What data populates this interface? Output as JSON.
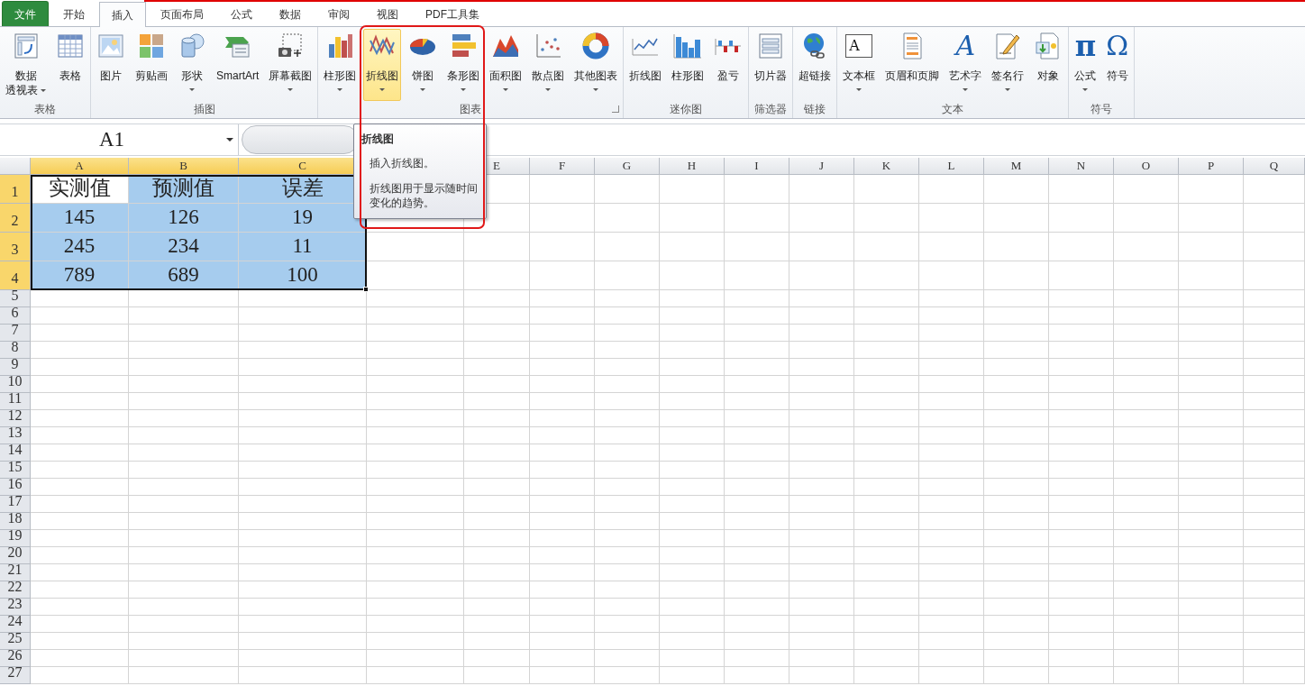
{
  "tabs": [
    {
      "label": "文件",
      "kind": "file",
      "selected": false
    },
    {
      "label": "开始",
      "kind": "tab",
      "selected": false
    },
    {
      "label": "插入",
      "kind": "tab",
      "selected": true
    },
    {
      "label": "页面布局",
      "kind": "tab",
      "selected": false
    },
    {
      "label": "公式",
      "kind": "tab",
      "selected": false
    },
    {
      "label": "数据",
      "kind": "tab",
      "selected": false
    },
    {
      "label": "审阅",
      "kind": "tab",
      "selected": false
    },
    {
      "label": "视图",
      "kind": "tab",
      "selected": false
    },
    {
      "label": "PDF工具集",
      "kind": "tab",
      "selected": false
    }
  ],
  "ribbon": [
    {
      "label": "表格",
      "launcher": false,
      "buttons": [
        {
          "label": "数据",
          "label_2": "透视表",
          "dropdown": true,
          "highlighted": false
        },
        {
          "label": "表格",
          "dropdown": false,
          "highlighted": false
        }
      ]
    },
    {
      "label": "插图",
      "launcher": false,
      "buttons": [
        {
          "label": "图片",
          "dropdown": false,
          "highlighted": false
        },
        {
          "label": "剪贴画",
          "dropdown": false,
          "highlighted": false
        },
        {
          "label": "形状",
          "dropdown": true,
          "highlighted": false
        },
        {
          "label": "SmartArt",
          "dropdown": false,
          "highlighted": false
        },
        {
          "label": "屏幕截图",
          "dropdown": true,
          "highlighted": false
        }
      ]
    },
    {
      "label": "图表",
      "launcher": true,
      "buttons": [
        {
          "label": "柱形图",
          "dropdown": true,
          "highlighted": false
        },
        {
          "label": "折线图",
          "dropdown": true,
          "highlighted": true
        },
        {
          "label": "饼图",
          "dropdown": true,
          "highlighted": false
        },
        {
          "label": "条形图",
          "dropdown": true,
          "highlighted": false
        },
        {
          "label": "面积图",
          "dropdown": true,
          "highlighted": false
        },
        {
          "label": "散点图",
          "dropdown": true,
          "highlighted": false
        },
        {
          "label": "其他图表",
          "dropdown": true,
          "highlighted": false
        }
      ]
    },
    {
      "label": "迷你图",
      "launcher": false,
      "buttons": [
        {
          "label": "折线图",
          "dropdown": false,
          "highlighted": false
        },
        {
          "label": "柱形图",
          "dropdown": false,
          "highlighted": false
        },
        {
          "label": "盈亏",
          "dropdown": false,
          "highlighted": false
        }
      ]
    },
    {
      "label": "筛选器",
      "launcher": false,
      "buttons": [
        {
          "label": "切片器",
          "dropdown": false,
          "highlighted": false
        }
      ]
    },
    {
      "label": "链接",
      "launcher": false,
      "buttons": [
        {
          "label": "超链接",
          "dropdown": false,
          "highlighted": false
        }
      ]
    },
    {
      "label": "文本",
      "launcher": false,
      "buttons": [
        {
          "label": "文本框",
          "glyph": "A",
          "dropdown": true,
          "highlighted": false
        },
        {
          "label": "页眉和页脚",
          "dropdown": false,
          "highlighted": false
        },
        {
          "label": "艺术字",
          "glyph": "A",
          "dropdown": true,
          "highlighted": false
        },
        {
          "label": "签名行",
          "dropdown": true,
          "highlighted": false
        },
        {
          "label": "对象",
          "dropdown": false,
          "highlighted": false
        }
      ]
    },
    {
      "label": "符号",
      "launcher": false,
      "buttons": [
        {
          "label": "公式",
          "glyph": "π",
          "dropdown": true,
          "highlighted": false
        },
        {
          "label": "符号",
          "glyph": "Ω",
          "dropdown": false,
          "highlighted": false
        }
      ]
    }
  ],
  "formula_bar": {
    "name_box": "A1"
  },
  "tooltip": {
    "title": "折线图",
    "lines": [
      "插入折线图。",
      "折线图用于显示随时间变化的趋势。"
    ]
  },
  "sheet": {
    "columns": [
      {
        "label": "A",
        "selected": true
      },
      {
        "label": "B",
        "selected": true
      },
      {
        "label": "C",
        "selected": true
      },
      {},
      {
        "label": "E",
        "selected": false
      },
      {
        "label": "F",
        "selected": false
      },
      {
        "label": "G",
        "selected": false
      },
      {
        "label": "H",
        "selected": false
      },
      {
        "label": "I",
        "selected": false
      },
      {
        "label": "J",
        "selected": false
      },
      {
        "label": "K",
        "selected": false
      },
      {
        "label": "L",
        "selected": false
      },
      {
        "label": "M",
        "selected": false
      },
      {
        "label": "N",
        "selected": false
      },
      {
        "label": "O",
        "selected": false
      },
      {
        "label": "P",
        "selected": false
      },
      {
        "label": "Q",
        "selected": false
      }
    ],
    "rows": [
      {
        "label": "1",
        "selected": true,
        "cells": [
          {
            "text": "实测值",
            "selected": true,
            "active": true
          },
          {
            "text": "预测值",
            "selected": true,
            "active": false
          },
          {
            "text": "误差",
            "selected": true,
            "active": false
          }
        ]
      },
      {
        "label": "2",
        "selected": true,
        "cells": [
          {
            "text": "145",
            "selected": true,
            "active": false
          },
          {
            "text": "126",
            "selected": true,
            "active": false
          },
          {
            "text": "19",
            "selected": true,
            "active": false
          }
        ]
      },
      {
        "label": "3",
        "selected": true,
        "cells": [
          {
            "text": "245",
            "selected": true,
            "active": false
          },
          {
            "text": "234",
            "selected": true,
            "active": false
          },
          {
            "text": "11",
            "selected": true,
            "active": false
          }
        ]
      },
      {
        "label": "4",
        "selected": true,
        "cells": [
          {
            "text": "789",
            "selected": true,
            "active": false
          },
          {
            "text": "689",
            "selected": true,
            "active": false
          },
          {
            "text": "100",
            "selected": true,
            "active": false
          }
        ]
      },
      {
        "label": "5",
        "selected": false
      },
      {
        "label": "6",
        "selected": false
      },
      {
        "label": "7",
        "selected": false
      },
      {
        "label": "8",
        "selected": false
      },
      {
        "label": "9",
        "selected": false
      },
      {
        "label": "10",
        "selected": false
      },
      {
        "label": "11",
        "selected": false
      },
      {
        "label": "12",
        "selected": false
      },
      {
        "label": "13",
        "selected": false
      },
      {
        "label": "14",
        "selected": false
      },
      {
        "label": "15",
        "selected": false
      },
      {
        "label": "16",
        "selected": false
      },
      {
        "label": "17",
        "selected": false
      },
      {
        "label": "18",
        "selected": false
      },
      {
        "label": "19",
        "selected": false
      },
      {
        "label": "20",
        "selected": false
      },
      {
        "label": "21",
        "selected": false
      },
      {
        "label": "22",
        "selected": false
      },
      {
        "label": "23",
        "selected": false
      },
      {
        "label": "24",
        "selected": false
      },
      {
        "label": "25",
        "selected": false
      },
      {
        "label": "26",
        "selected": false
      },
      {
        "label": "27",
        "selected": false
      }
    ]
  }
}
